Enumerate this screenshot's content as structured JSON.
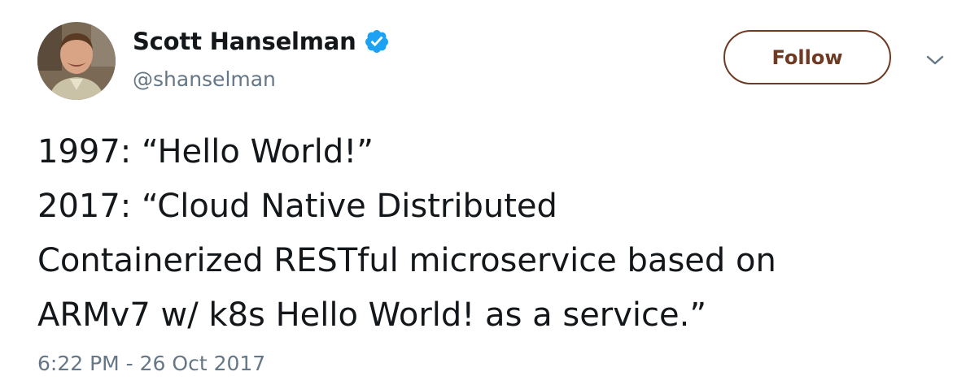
{
  "author": {
    "name": "Scott Hanselman",
    "handle": "@shanselman",
    "verified": true,
    "avatar_icon": "profile-photo"
  },
  "actions": {
    "follow_label": "Follow",
    "more_icon": "chevron-down-icon"
  },
  "tweet": {
    "lines": [
      "1997: “Hello World!”",
      "2017: “Cloud Native Distributed",
      "Containerized RESTful microservice based on",
      "ARMv7 w/ k8s Hello World! as a service.”"
    ],
    "timestamp": "6:22 PM - 26 Oct 2017"
  },
  "colors": {
    "follow_accent": "#6d3a23",
    "verified_blue": "#1da1f2",
    "secondary_text": "#657786",
    "primary_text": "#14171a"
  }
}
